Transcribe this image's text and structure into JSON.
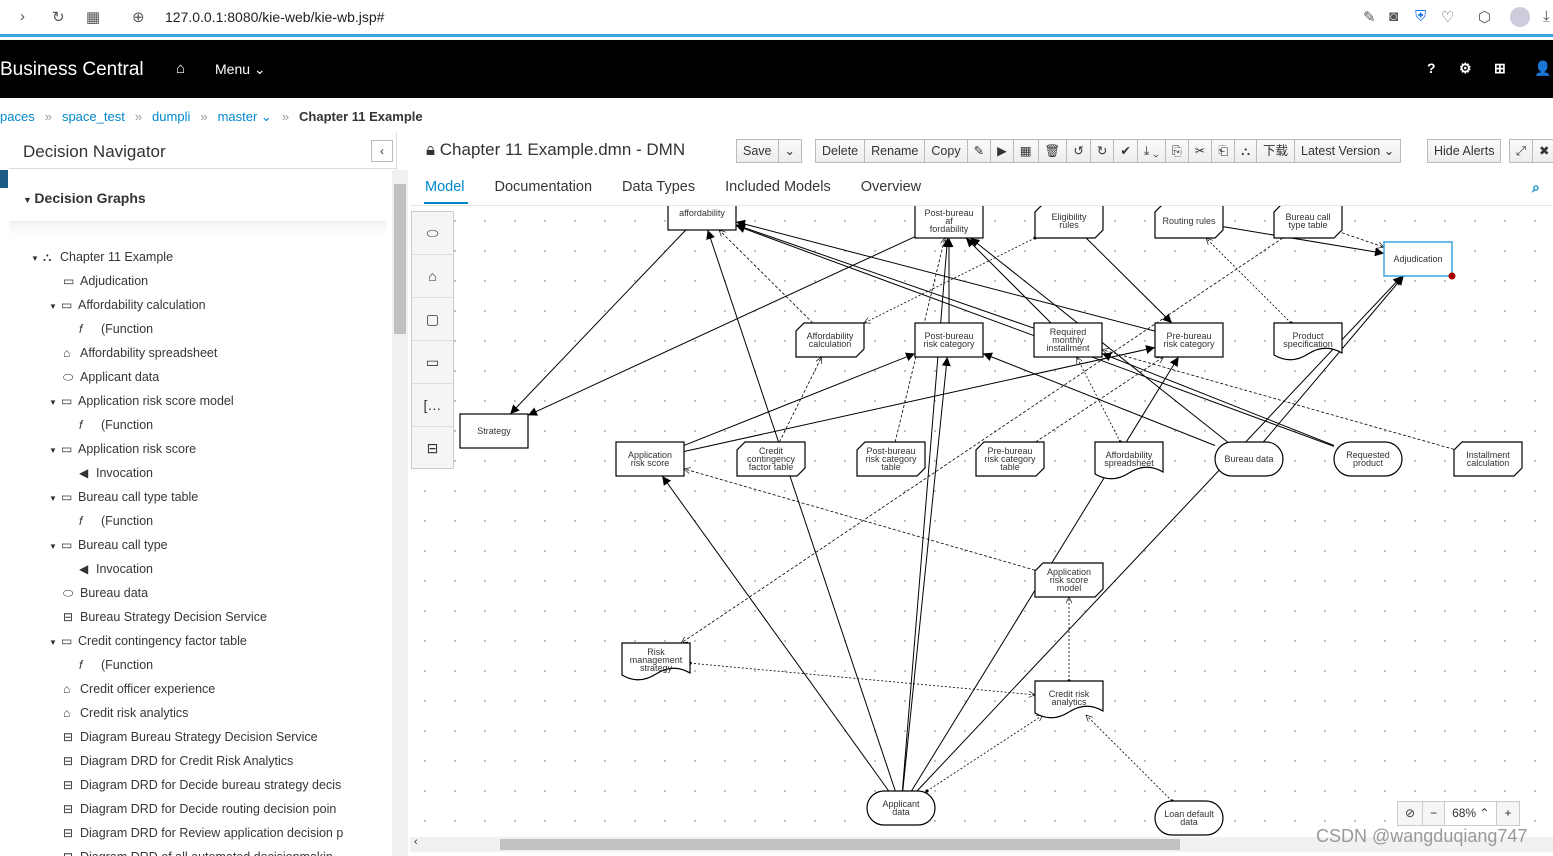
{
  "browser": {
    "url": "127.0.0.1:8080/kie-web/kie-wb.jsp#"
  },
  "header": {
    "brand": "Business Central",
    "menu": "Menu ⌄",
    "help": "?"
  },
  "breadcrumb": [
    "paces",
    "space_test",
    "dumpli",
    "master ⌄",
    "Chapter 11 Example"
  ],
  "navigator": {
    "title": "Decision Navigator",
    "section": "Decision Graphs",
    "items": [
      {
        "label": "Chapter 11 Example",
        "level": 0,
        "caret": true,
        "icon": "⛬"
      },
      {
        "label": "Adjudication",
        "level": 1,
        "icon": "▭"
      },
      {
        "label": "Affordability calculation",
        "level": 1,
        "caret": true,
        "icon": "▭"
      },
      {
        "label": "(Function",
        "level": 2,
        "icon": "𝑓"
      },
      {
        "label": "Affordability spreadsheet",
        "level": 1,
        "icon": "⌂"
      },
      {
        "label": "Applicant data",
        "level": 1,
        "icon": "⬭"
      },
      {
        "label": "Application risk score model",
        "level": 1,
        "caret": true,
        "icon": "▭"
      },
      {
        "label": "(Function",
        "level": 2,
        "icon": "𝑓"
      },
      {
        "label": "Application risk score",
        "level": 1,
        "caret": true,
        "icon": "▭"
      },
      {
        "label": "Invocation",
        "level": 2,
        "icon": "◀"
      },
      {
        "label": "Bureau call type table",
        "level": 1,
        "caret": true,
        "icon": "▭"
      },
      {
        "label": "(Function",
        "level": 2,
        "icon": "𝑓"
      },
      {
        "label": "Bureau call type",
        "level": 1,
        "caret": true,
        "icon": "▭"
      },
      {
        "label": "Invocation",
        "level": 2,
        "icon": "◀"
      },
      {
        "label": "Bureau data",
        "level": 1,
        "icon": "⬭"
      },
      {
        "label": "Bureau Strategy Decision Service",
        "level": 1,
        "icon": "⊟"
      },
      {
        "label": "Credit contingency factor table",
        "level": 1,
        "caret": true,
        "icon": "▭"
      },
      {
        "label": "(Function",
        "level": 2,
        "icon": "𝑓"
      },
      {
        "label": "Credit officer experience",
        "level": 1,
        "icon": "⌂"
      },
      {
        "label": "Credit risk analytics",
        "level": 1,
        "icon": "⌂"
      },
      {
        "label": "Diagram Bureau Strategy Decision Service",
        "level": 1,
        "icon": "⊟"
      },
      {
        "label": "Diagram DRD for Credit Risk Analytics",
        "level": 1,
        "icon": "⊟"
      },
      {
        "label": "Diagram DRD for Decide bureau strategy decis",
        "level": 1,
        "icon": "⊟"
      },
      {
        "label": "Diagram DRD for Decide routing decision poin",
        "level": 1,
        "icon": "⊟"
      },
      {
        "label": "Diagram DRD for Review application decision p",
        "level": 1,
        "icon": "⊟"
      },
      {
        "label": "Diagram DRD of all automated decisionmakin",
        "level": 1,
        "icon": "⊟"
      }
    ]
  },
  "editor": {
    "title": "Chapter 11 Example.dmn - DMN",
    "toolbar1": [
      "Save",
      "⌄"
    ],
    "toolbar2": [
      "Delete",
      "Rename",
      "Copy",
      "✎",
      "▶",
      "▦",
      "🗑",
      "↺",
      "↻",
      "✔",
      "⤓ ⌄",
      "⎘",
      "✂",
      "⎗",
      "⛬",
      "下载",
      "Latest Version ⌄"
    ],
    "toolbar3": [
      "Hide Alerts"
    ],
    "toolbar4": [
      "⤢",
      "✖"
    ],
    "tabs": [
      "Model",
      "Documentation",
      "Data Types",
      "Included Models",
      "Overview"
    ],
    "zoom": "68% ⌃"
  },
  "diagram": {
    "nodes": [
      {
        "id": "saff",
        "label": "affordability",
        "type": "decision"
      },
      {
        "id": "pba",
        "label": "Post-bureau af fordability",
        "type": "decision"
      },
      {
        "id": "elig",
        "label": "Eligibility rules",
        "type": "bkm"
      },
      {
        "id": "rout",
        "label": "Routing rules",
        "type": "bkm"
      },
      {
        "id": "bct",
        "label": "Bureau call type table",
        "type": "bkm"
      },
      {
        "id": "adj",
        "label": "Adjudication",
        "type": "decision",
        "selected": true
      },
      {
        "id": "strat",
        "label": "Strategy",
        "type": "decision"
      },
      {
        "id": "affc",
        "label": "Affordability calculation",
        "type": "bkm"
      },
      {
        "id": "pbrc",
        "label": "Post-bureau risk category",
        "type": "decision"
      },
      {
        "id": "rmi",
        "label": "Required monthly installment",
        "type": "decision"
      },
      {
        "id": "prbrc",
        "label": "Pre-bureau risk category",
        "type": "decision"
      },
      {
        "id": "prod",
        "label": "Product specification",
        "type": "knowledge"
      },
      {
        "id": "ars",
        "label": "Application risk score",
        "type": "decision"
      },
      {
        "id": "ccft",
        "label": "Credit contingency factor table",
        "type": "bkm"
      },
      {
        "id": "pbrct",
        "label": "Post-bureau risk category table",
        "type": "bkm"
      },
      {
        "id": "prbrct",
        "label": "Pre-bureau risk category table",
        "type": "bkm"
      },
      {
        "id": "affs",
        "label": "Affordability spreadsheet",
        "type": "knowledge"
      },
      {
        "id": "bd",
        "label": "Bureau data",
        "type": "input"
      },
      {
        "id": "rp",
        "label": "Requested product",
        "type": "input"
      },
      {
        "id": "ic",
        "label": "Installment calculation",
        "type": "bkm"
      },
      {
        "id": "arsm",
        "label": "Application risk score model",
        "type": "bkm"
      },
      {
        "id": "rms",
        "label": "Risk management strategy",
        "type": "knowledge"
      },
      {
        "id": "cra",
        "label": "Credit risk analytics",
        "type": "knowledge"
      },
      {
        "id": "ad",
        "label": "Applicant data",
        "type": "input"
      },
      {
        "id": "ldd",
        "label": "Loan default data",
        "type": "input"
      }
    ],
    "edges": [
      [
        "ad",
        "saff",
        "info"
      ],
      [
        "ad",
        "pba",
        "info"
      ],
      [
        "ad",
        "pbrc",
        "info"
      ],
      [
        "ad",
        "ars",
        "info"
      ],
      [
        "ad",
        "prbrc",
        "info"
      ],
      [
        "ad",
        "adj",
        "info"
      ],
      [
        "bd",
        "pbrc",
        "info"
      ],
      [
        "bd",
        "adj",
        "info"
      ],
      [
        "bd",
        "pba",
        "info"
      ],
      [
        "rp",
        "rmi",
        "info"
      ],
      [
        "rp",
        "saff",
        "info"
      ],
      [
        "pbrc",
        "pba",
        "info"
      ],
      [
        "rmi",
        "pba",
        "info"
      ],
      [
        "rmi",
        "saff",
        "info"
      ],
      [
        "prbrc",
        "saff",
        "info"
      ],
      [
        "ars",
        "pbrc",
        "info"
      ],
      [
        "ars",
        "prbrc",
        "info"
      ],
      [
        "pba",
        "strat",
        "info"
      ],
      [
        "saff",
        "strat",
        "info"
      ],
      [
        "elig",
        "prbrc",
        "info"
      ],
      [
        "rout",
        "adj",
        "info"
      ],
      [
        "affc",
        "saff",
        "knowledge"
      ],
      [
        "ccft",
        "affc",
        "knowledge"
      ],
      [
        "pbrct",
        "pba",
        "knowledge"
      ],
      [
        "prbrct",
        "prbrc",
        "knowledge"
      ],
      [
        "bct",
        "rms",
        "knowledge"
      ],
      [
        "arsm",
        "ars",
        "knowledge"
      ],
      [
        "ic",
        "rmi",
        "knowledge"
      ],
      [
        "affs",
        "rmi",
        "authority"
      ],
      [
        "prod",
        "rout",
        "authority"
      ],
      [
        "rms",
        "cra",
        "authority"
      ],
      [
        "ldd",
        "cra",
        "authority"
      ],
      [
        "ad",
        "cra",
        "authority"
      ],
      [
        "cra",
        "arsm",
        "authority"
      ],
      [
        "bct",
        "adj",
        "knowledge"
      ],
      [
        "elig",
        "affc",
        "authority"
      ]
    ]
  },
  "watermark": "CSDN @wangduqiang747"
}
